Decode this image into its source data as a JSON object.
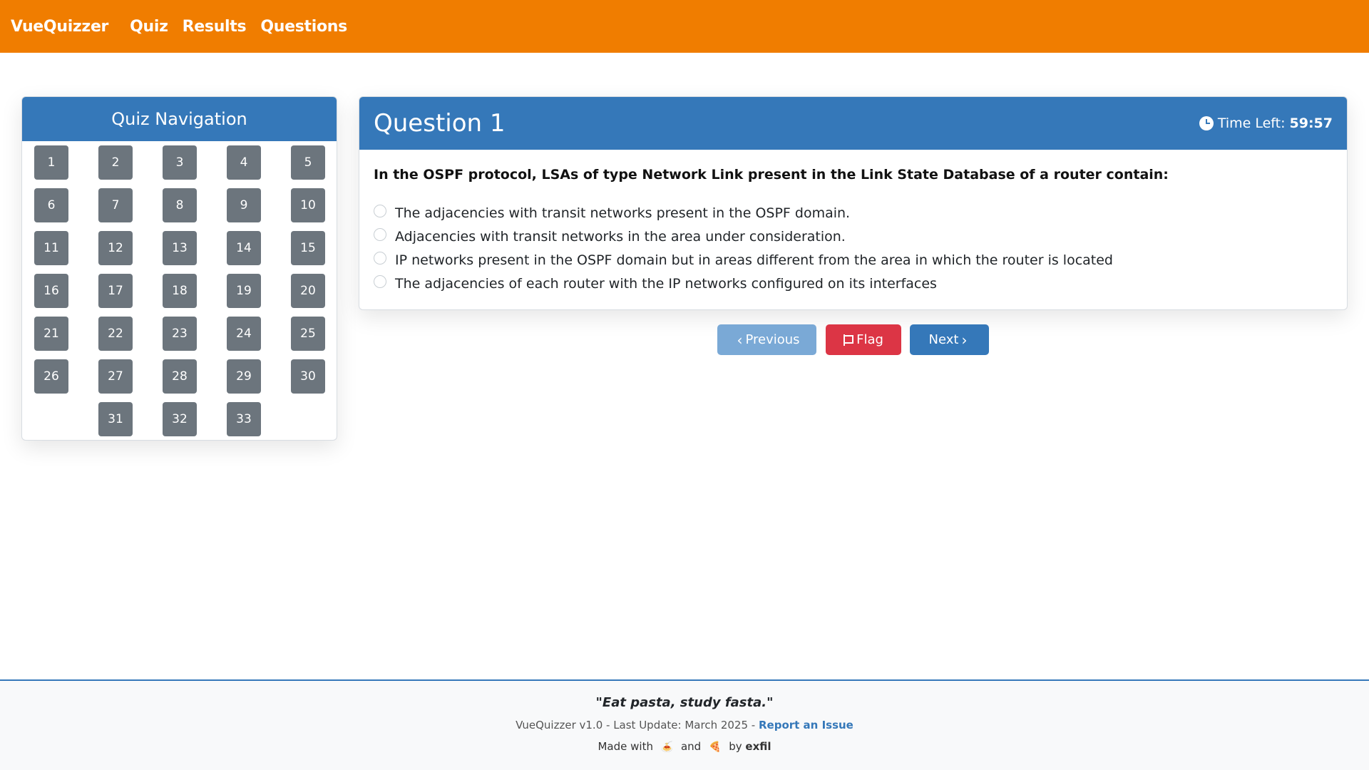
{
  "navbar": {
    "brand": "VueQuizzer",
    "links": [
      "Quiz",
      "Results",
      "Questions"
    ]
  },
  "sidebar": {
    "title": "Quiz Navigation",
    "questions": [
      "1",
      "2",
      "3",
      "4",
      "5",
      "6",
      "7",
      "8",
      "9",
      "10",
      "11",
      "12",
      "13",
      "14",
      "15",
      "16",
      "17",
      "18",
      "19",
      "20",
      "21",
      "22",
      "23",
      "24",
      "25",
      "26",
      "27",
      "28",
      "29",
      "30",
      "31",
      "32",
      "33"
    ]
  },
  "question": {
    "title": "Question 1",
    "timer_label": "Time Left:",
    "timer_value": "59:57",
    "text": "In the OSPF protocol, LSAs of type Network Link present in the Link State Database of a router contain:",
    "options": [
      "The adjacencies with transit networks present in the OSPF domain.",
      "Adjacencies with transit networks in the area under consideration.",
      "IP networks present in the OSPF domain but in areas different from the area in which the router is located",
      "The adjacencies of each router with the IP networks configured on its interfaces"
    ]
  },
  "actions": {
    "previous": "Previous",
    "flag": "Flag",
    "next": "Next"
  },
  "footer": {
    "quote": "\"Eat pasta, study fasta.\"",
    "meta_text": "VueQuizzer v1.0 - Last Update: March 2025 -",
    "report_link": "Report an Issue",
    "made_with": "Made with",
    "and": "and",
    "by": "by",
    "author": "exfil",
    "emoji1": "🍝",
    "emoji2": "🍕"
  },
  "colors": {
    "navbar": "#f07d00",
    "primary": "#3578b9",
    "secondary": "#6c757d",
    "danger": "#dc3545"
  }
}
